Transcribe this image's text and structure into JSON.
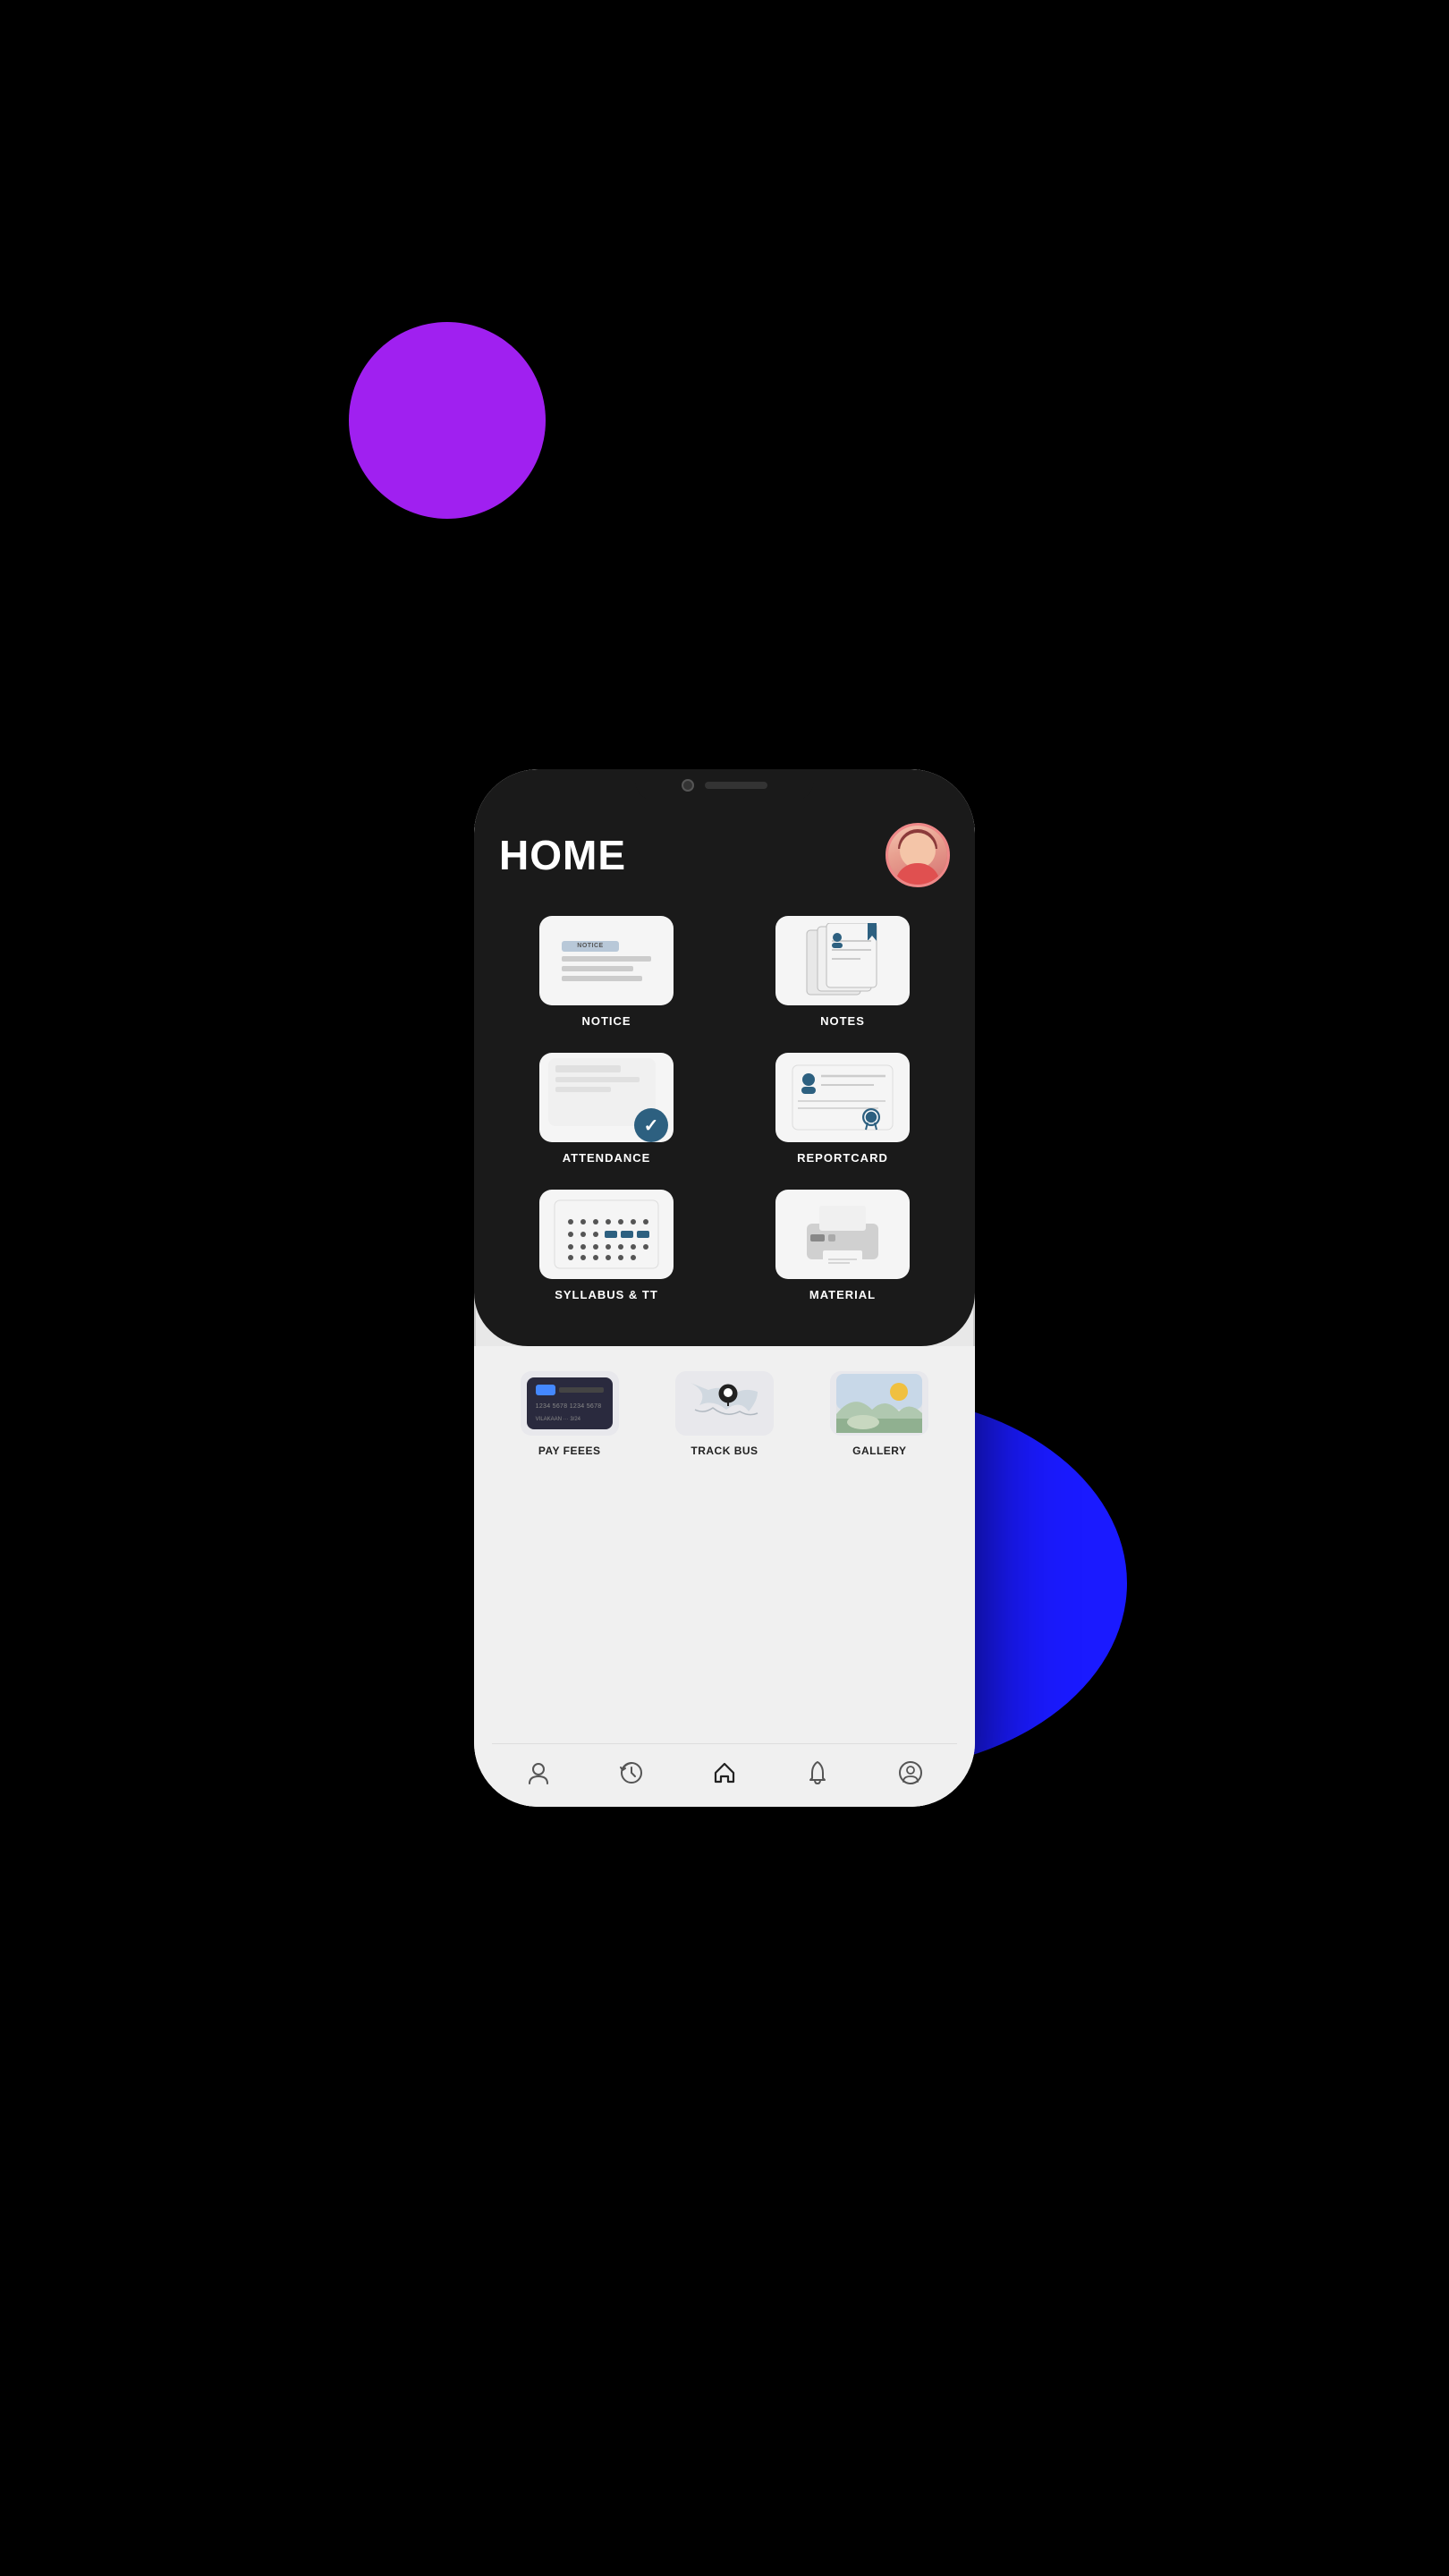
{
  "background": {
    "blob_purple_color": "#a020f0",
    "blob_blue_color": "#1a1aff"
  },
  "header": {
    "title": "HOME",
    "avatar_alt": "Student girl with glasses"
  },
  "grid_items": [
    {
      "id": "notice",
      "label": "NOTICE",
      "icon": "notice-icon"
    },
    {
      "id": "notes",
      "label": "NOTES",
      "icon": "notes-icon"
    },
    {
      "id": "attendance",
      "label": "ATTENDANCE",
      "icon": "attendance-icon"
    },
    {
      "id": "reportcard",
      "label": "REPORTCARD",
      "icon": "reportcard-icon"
    },
    {
      "id": "syllabus",
      "label": "SYLLABUS & TT",
      "icon": "syllabus-icon"
    },
    {
      "id": "material",
      "label": "MATERIAL",
      "icon": "material-icon"
    }
  ],
  "bottom_items": [
    {
      "id": "pay-fees",
      "label": "PAY FEEES",
      "icon": "payfees-icon"
    },
    {
      "id": "track-bus",
      "label": "TRACK BUS",
      "icon": "trackbus-icon"
    },
    {
      "id": "gallery",
      "label": "GALLERY",
      "icon": "gallery-icon"
    }
  ],
  "nav_items": [
    {
      "id": "profile",
      "icon": "person-icon",
      "label": "Profile"
    },
    {
      "id": "history",
      "icon": "history-icon",
      "label": "History"
    },
    {
      "id": "home",
      "icon": "home-icon",
      "label": "Home",
      "active": true
    },
    {
      "id": "notifications",
      "icon": "bell-icon",
      "label": "Notifications"
    },
    {
      "id": "account",
      "icon": "account-icon",
      "label": "Account"
    }
  ]
}
